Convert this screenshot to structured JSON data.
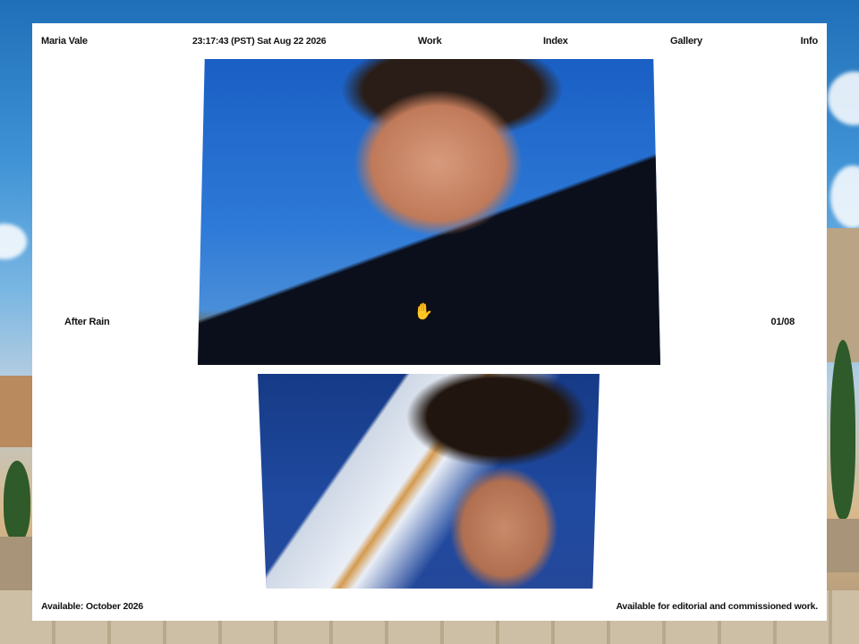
{
  "header": {
    "site_name": "Maria Vale",
    "clock": "23:17:43 (PST) Sat Aug 22 2026",
    "nav": {
      "work": "Work",
      "index": "Index",
      "gallery": "Gallery",
      "info": "Info"
    }
  },
  "project": {
    "title": "After Rain",
    "counter": "01/08"
  },
  "footer": {
    "availability": "Available: October 2026",
    "note": "Available for editorial and commissioned work."
  },
  "icons": {
    "cursor": "hand-cursor-icon"
  }
}
